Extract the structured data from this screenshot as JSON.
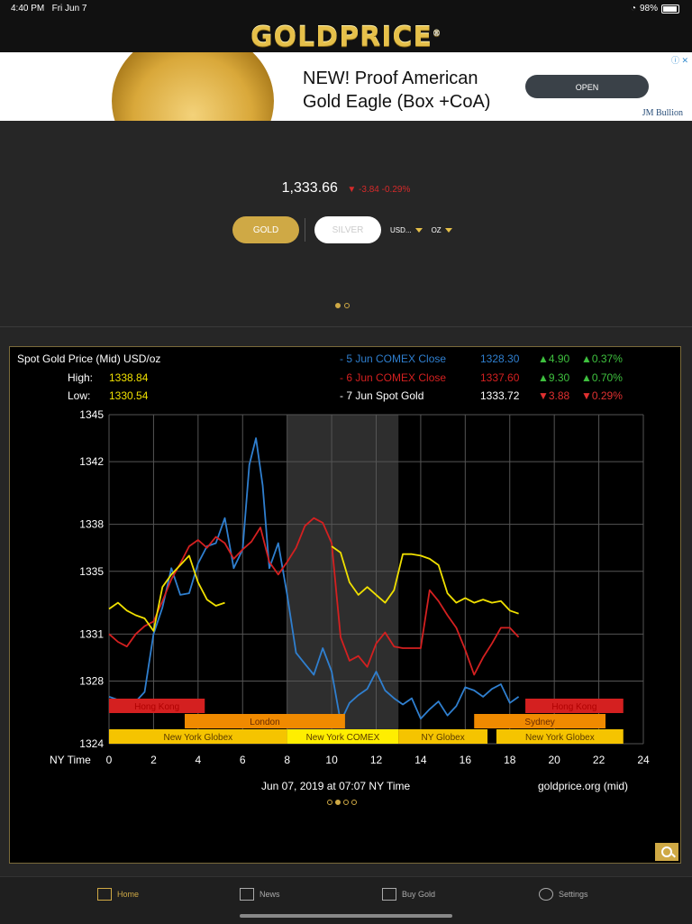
{
  "status": {
    "time": "4:40 PM",
    "date": "Fri Jun 7",
    "battery": "98%"
  },
  "header": {
    "logo": "GOLDPRICE",
    "reg": "®"
  },
  "ad": {
    "title_line1": "NEW! Proof American",
    "title_line2": "Gold Eagle (Box +CoA)",
    "button": "OPEN",
    "brand": "JM Bullion",
    "info": "ⓘ ✕"
  },
  "price": {
    "value": "1,333.66",
    "change": "-3.84  -0.29%"
  },
  "controls": {
    "gold": "GOLD",
    "silver": "SILVER",
    "currency": "USD...",
    "unit": "OZ"
  },
  "chart_data": {
    "type": "line",
    "title": "Spot Gold Price (Mid) USD/oz",
    "high_label": "High:",
    "high": "1338.84",
    "low_label": "Low:",
    "low": "1330.54",
    "legend": [
      {
        "label": "- 5 Jun COMEX Close",
        "close": "1328.30",
        "chg": "▲4.90",
        "pct": "▲0.37%",
        "color": "#2f7fcf",
        "chg_color": "#3ec03e"
      },
      {
        "label": "- 6 Jun COMEX Close",
        "close": "1337.60",
        "chg": "▲9.30",
        "pct": "▲0.70%",
        "color": "#d42020",
        "chg_color": "#3ec03e"
      },
      {
        "label": "- 7 Jun Spot Gold",
        "close": "1333.72",
        "chg": "▼3.88",
        "pct": "▼0.29%",
        "color": "#f0e000",
        "chg_color": "#e03030"
      }
    ],
    "x_label": "NY Time",
    "xlim": [
      0,
      24
    ],
    "ylim": [
      1324,
      1345
    ],
    "x_ticks": [
      0,
      2,
      4,
      6,
      8,
      10,
      12,
      14,
      16,
      18,
      20,
      22,
      24
    ],
    "y_ticks": [
      1324,
      1328,
      1331,
      1335,
      1338,
      1342,
      1345
    ],
    "shaded": [
      8,
      13
    ],
    "series": [
      {
        "name": "5 Jun COMEX Close",
        "color": "#2f7fcf",
        "x": [
          0,
          0.4,
          0.8,
          1.2,
          1.6,
          2.0,
          2.4,
          2.8,
          3.2,
          3.6,
          4.0,
          4.4,
          4.8,
          5.2,
          5.6,
          6.0,
          6.3,
          6.6,
          6.9,
          7.2,
          7.6,
          8.0,
          8.4,
          8.8,
          9.2,
          9.6,
          10.0,
          10.4,
          10.8,
          11.2,
          11.6,
          12.0,
          12.4,
          12.8,
          13.2,
          13.6,
          14.0,
          14.4,
          14.8,
          15.2,
          15.6,
          16.0,
          16.4,
          16.8,
          17.2,
          17.6,
          18.0,
          18.4
        ],
        "y": [
          1327.0,
          1326.8,
          1326.2,
          1326.7,
          1327.3,
          1331.0,
          1332.7,
          1335.2,
          1333.5,
          1333.6,
          1335.5,
          1336.6,
          1336.8,
          1338.4,
          1335.2,
          1336.4,
          1341.8,
          1343.5,
          1340.5,
          1335.2,
          1336.8,
          1333.5,
          1329.8,
          1329.1,
          1328.4,
          1330.1,
          1328.6,
          1325.4,
          1326.6,
          1327.1,
          1327.5,
          1328.6,
          1327.4,
          1326.9,
          1326.5,
          1326.9,
          1325.6,
          1326.2,
          1326.7,
          1325.8,
          1326.4,
          1327.6,
          1327.4,
          1327.0,
          1327.5,
          1327.8,
          1326.6,
          1327.0
        ]
      },
      {
        "name": "6 Jun COMEX Close",
        "color": "#d42020",
        "x": [
          0,
          0.4,
          0.8,
          1.2,
          1.6,
          2.0,
          2.4,
          2.8,
          3.2,
          3.6,
          4.0,
          4.4,
          4.8,
          5.2,
          5.6,
          6.0,
          6.4,
          6.8,
          7.2,
          7.6,
          8.0,
          8.4,
          8.8,
          9.2,
          9.6,
          10.0,
          10.4,
          10.8,
          11.2,
          11.6,
          12.0,
          12.4,
          12.8,
          13.2,
          13.6,
          14.0,
          14.4,
          14.8,
          15.2,
          15.6,
          16.0,
          16.4,
          16.8,
          17.2,
          17.6,
          18.0,
          18.4
        ],
        "y": [
          1331.0,
          1330.5,
          1330.2,
          1331.0,
          1331.5,
          1331.8,
          1333.1,
          1334.5,
          1335.5,
          1336.6,
          1337.0,
          1336.5,
          1337.2,
          1336.8,
          1335.8,
          1336.4,
          1336.9,
          1337.8,
          1335.6,
          1334.8,
          1335.6,
          1336.5,
          1337.9,
          1338.4,
          1338.1,
          1336.8,
          1330.8,
          1329.3,
          1329.6,
          1328.9,
          1330.4,
          1331.1,
          1330.2,
          1330.1,
          1330.1,
          1330.1,
          1333.8,
          1333.1,
          1332.2,
          1331.4,
          1330.0,
          1328.4,
          1329.5,
          1330.4,
          1331.4,
          1331.4,
          1330.8
        ]
      },
      {
        "name": "7 Jun Spot Gold",
        "color": "#f0e000",
        "x": [
          0,
          0.4,
          0.8,
          1.2,
          1.6,
          2.0,
          2.4,
          2.8,
          3.2,
          3.6,
          4.0,
          4.4,
          4.8,
          5.2,
          5.6,
          6.0,
          6.4,
          6.8,
          7.2,
          7.6,
          8.0,
          8.4,
          8.8,
          9.2,
          9.6,
          10.0,
          10.4,
          10.8,
          11.2,
          11.6,
          12.0,
          12.4,
          12.8,
          13.2,
          13.6,
          14.0,
          14.4,
          14.8,
          15.2,
          15.6,
          16.0,
          16.4,
          16.8,
          17.2,
          17.6,
          18.0,
          18.4
        ],
        "y": [
          1332.6,
          1333.0,
          1332.5,
          1332.2,
          1332.0,
          1331.2,
          1334.0,
          1334.8,
          1335.4,
          1336.0,
          1334.3,
          1333.2,
          1332.8,
          1333.0,
          null,
          null,
          null,
          null,
          null,
          null,
          null,
          null,
          null,
          null,
          null,
          1336.6,
          1336.2,
          1334.3,
          1333.5,
          1334.0,
          1333.5,
          1333.0,
          1333.8,
          1336.1,
          1336.1,
          1336.0,
          1335.8,
          1335.4,
          1333.6,
          1333.0,
          1333.3,
          1333.0,
          1333.2,
          1333.0,
          1333.1,
          1332.5,
          1332.3
        ]
      }
    ],
    "sessions": [
      {
        "label": "Hong Kong",
        "start": 0,
        "end": 4.3,
        "row": 0,
        "color": "#d42020",
        "text_color": "#b00000"
      },
      {
        "label": "Hong Kong",
        "start": 18.7,
        "end": 23.1,
        "row": 0,
        "color": "#d42020",
        "text_color": "#b00000"
      },
      {
        "label": "London",
        "start": 3.4,
        "end": 10.6,
        "row": 1,
        "color": "#f08a00",
        "text_color": "#6a2a00"
      },
      {
        "label": "Sydney",
        "start": 16.4,
        "end": 22.3,
        "row": 1,
        "color": "#f08a00",
        "text_color": "#6a2a00"
      },
      {
        "label": "New York Globex",
        "start": 0,
        "end": 8.0,
        "row": 2,
        "color": "#f5c400",
        "text_color": "#5a3a00"
      },
      {
        "label": "New York COMEX",
        "start": 8.0,
        "end": 13.0,
        "row": 2,
        "color": "#ffee00",
        "text_color": "#5a3a00"
      },
      {
        "label": "NY Globex",
        "start": 13.0,
        "end": 17.0,
        "row": 2,
        "color": "#f5c400",
        "text_color": "#5a3a00"
      },
      {
        "label": "New York Globex",
        "start": 17.4,
        "end": 23.1,
        "row": 2,
        "color": "#f5c400",
        "text_color": "#5a3a00"
      }
    ],
    "footer_time": "Jun 07, 2019 at 07:07 NY Time",
    "footer_source": "goldprice.org (mid)"
  },
  "tabs": [
    {
      "label": "Home",
      "icon": "home-icon"
    },
    {
      "label": "News",
      "icon": "news-icon"
    },
    {
      "label": "Buy Gold",
      "icon": "buy-gold-icon"
    },
    {
      "label": "Settings",
      "icon": "settings-icon"
    }
  ]
}
